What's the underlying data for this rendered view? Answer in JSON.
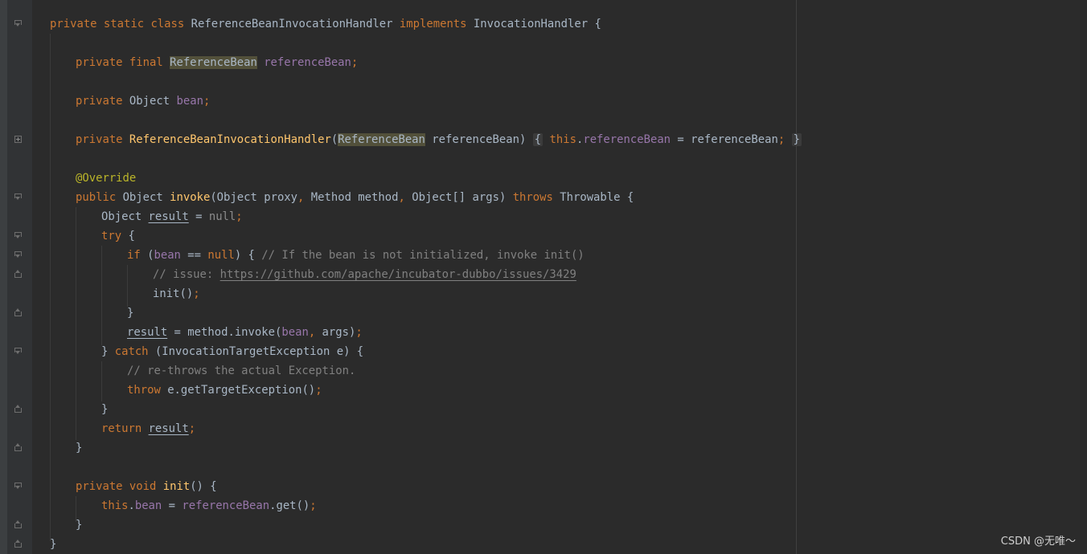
{
  "editor": {
    "lines": {
      "class_decl": {
        "k1": "private static class",
        "name": "ReferenceBeanInvocationHandler",
        "k2": "implements",
        "iface": "InvocationHandler",
        "brace": "{"
      },
      "field1": {
        "k": "private final",
        "type": "ReferenceBean",
        "name": "referenceBean",
        "semi": ";"
      },
      "field2": {
        "k": "private",
        "type": "Object",
        "name": "bean",
        "semi": ";"
      },
      "ctor": {
        "k": "private",
        "name": "ReferenceBeanInvocationHandler",
        "open": "(",
        "ptype": "ReferenceBean",
        "pname": "referenceBean)",
        "lb": "{",
        "this": "this",
        "dot": ".",
        "fld": "referenceBean",
        "rest": " = referenceBean",
        "semi": ";",
        "rb": "}"
      },
      "annotation": "@Override",
      "invoke_sig": {
        "k": "public",
        "ret": "Object",
        "name": "invoke",
        "params1": "(Object proxy",
        "c1": ",",
        "params2": " Method method",
        "c2": ",",
        "params3": " Object[] args) ",
        "throws": "throws",
        "exc": " Throwable {"
      },
      "result_decl": {
        "type": "Object ",
        "var": "result",
        "eq": " = ",
        "null": "null",
        "semi": ";"
      },
      "try_line": {
        "k": "try",
        "brace": " {"
      },
      "if_line": {
        "k": "if",
        "open": " (",
        "fld": "bean",
        "op": " == ",
        "null": "null",
        "close": ") { ",
        "comment": "// If the bean is not initialized, invoke init()"
      },
      "issue_line": {
        "comment": "// issue: ",
        "link": "https://github.com/apache/incubator-dubbo/issues/3429"
      },
      "init_call": {
        "call": "init()",
        "semi": ";"
      },
      "close_if": "}",
      "assign_line": {
        "var": "result",
        "mid": " = method.invoke(",
        "fld": "bean",
        "c": ",",
        "rest": " args)",
        "semi": ";"
      },
      "catch_line": {
        "rb": "} ",
        "k": "catch",
        "rest": " (InvocationTargetException e) {"
      },
      "rethrow_comment": "// re-throws the actual Exception.",
      "throw_line": {
        "k": "throw",
        "rest": " e.getTargetException()",
        "semi": ";"
      },
      "close_try": "}",
      "return_line": {
        "k": "return",
        "sp": " ",
        "var": "result",
        "semi": ";"
      },
      "close_invoke": "}",
      "init_sig": {
        "k": "private void",
        "name": "init",
        "rest": "() {"
      },
      "init_body": {
        "this": "this",
        "dot": ".",
        "fld": "bean",
        "eq": " = ",
        "fld2": "referenceBean",
        "rest": ".get()",
        "semi": ";"
      },
      "close_init": "}",
      "close_class": "}"
    }
  },
  "watermark": "CSDN @无唯～"
}
